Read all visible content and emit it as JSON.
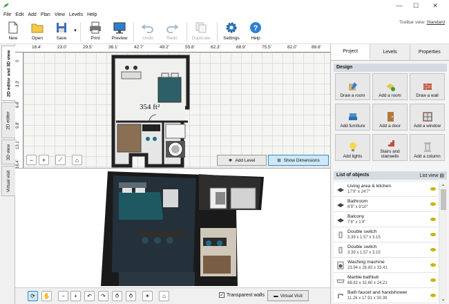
{
  "window": {
    "minimize": "—",
    "maximize": "☐",
    "close": "✕"
  },
  "menu": [
    "File",
    "Edit",
    "Add",
    "Plan",
    "View",
    "Levels",
    "Help"
  ],
  "toolbar": {
    "buttons": [
      {
        "id": "new",
        "label": "New",
        "enabled": true
      },
      {
        "id": "open",
        "label": "Open",
        "enabled": true
      },
      {
        "id": "save",
        "label": "Save",
        "enabled": true
      },
      {
        "id": "print",
        "label": "Print",
        "enabled": true
      },
      {
        "id": "preview",
        "label": "Preview",
        "enabled": true
      },
      {
        "id": "undo",
        "label": "Undo",
        "enabled": false
      },
      {
        "id": "redo",
        "label": "Redo",
        "enabled": false
      },
      {
        "id": "duplicate",
        "label": "Duplicate",
        "enabled": false
      },
      {
        "id": "settings",
        "label": "Settings",
        "enabled": true
      },
      {
        "id": "help",
        "label": "Help",
        "enabled": true
      }
    ],
    "view_label": "Toolbar view:",
    "view_value": "Standard"
  },
  "side_tabs": [
    {
      "label": "2D editor and 3D view",
      "active": true
    },
    {
      "label": "2D editor",
      "active": false
    },
    {
      "label": "3D view",
      "active": false
    },
    {
      "label": "Virtual visit",
      "active": false
    }
  ],
  "ruler": {
    "top": [
      "16.4'",
      "23.0'",
      "29.5'",
      "36.1'",
      "42.7'",
      "49.2'",
      "55.8'",
      "62.3'",
      "68.9'",
      "75.5'",
      "82.0'",
      "88.6'"
    ],
    "left": [
      "0",
      "3.3'",
      "6.6'",
      "9.8'",
      "13.1'",
      "16.4'"
    ]
  },
  "plan": {
    "area_label": "354 ft²",
    "add_level": "Add Level",
    "show_dimensions": "Show Dimensions"
  },
  "bottom": {
    "transparent_walls": "Transparent walls",
    "transparent_checked": true,
    "virtual_visit": "Virtual Visit"
  },
  "right_panel": {
    "tabs": [
      {
        "label": "Project",
        "active": true
      },
      {
        "label": "Levels",
        "active": false
      },
      {
        "label": "Properties",
        "active": false
      }
    ],
    "design_header": "Design",
    "design_buttons": [
      {
        "label": "Draw a room",
        "icon": "draw-room-icon"
      },
      {
        "label": "Add a room",
        "icon": "add-room-icon"
      },
      {
        "label": "Draw a wall",
        "icon": "brick-wall-icon"
      },
      {
        "label": "Add furniture",
        "icon": "armchair-icon"
      },
      {
        "label": "Add a door",
        "icon": "door-icon"
      },
      {
        "label": "Add a window",
        "icon": "window-icon"
      },
      {
        "label": "Add lights",
        "icon": "lightbulb-icon"
      },
      {
        "label": "Stairs and stairwells",
        "icon": "stairs-icon"
      },
      {
        "label": "Add a column",
        "icon": "column-icon"
      }
    ],
    "objects_header": "List of objects",
    "list_view": "List view",
    "objects": [
      {
        "name": "Living area & kitchen",
        "dims": "17'9\" x 24'7\"",
        "icon": "room-icon"
      },
      {
        "name": "Bathroom",
        "dims": "6'9\" x 9'10\"",
        "icon": "room-icon"
      },
      {
        "name": "Balcony",
        "dims": "7'8\" x 1'4\"",
        "icon": "room-icon"
      },
      {
        "name": "Double switch",
        "dims": "3.39 x 1.57 x 3.15",
        "icon": "switch-icon"
      },
      {
        "name": "Double switch",
        "dims": "3.39 x 1.57 x 3.15",
        "icon": "switch-icon"
      },
      {
        "name": "Washing machine",
        "dims": "23.94 x 26.83 x 33.41",
        "icon": "washing-machine-icon"
      },
      {
        "name": "Marble bathtub",
        "dims": "68.82 x 32.60 x 24.21",
        "icon": "bathtub-icon"
      },
      {
        "name": "Bath faucet and handshower",
        "dims": "11.26 x 17.91 x 30.39",
        "icon": "faucet-icon"
      }
    ]
  },
  "colors": {
    "accent": "#3a86c8",
    "section_header": "#d6dbe2",
    "active_button": "#cde8f6",
    "eye": "#c8b400"
  }
}
